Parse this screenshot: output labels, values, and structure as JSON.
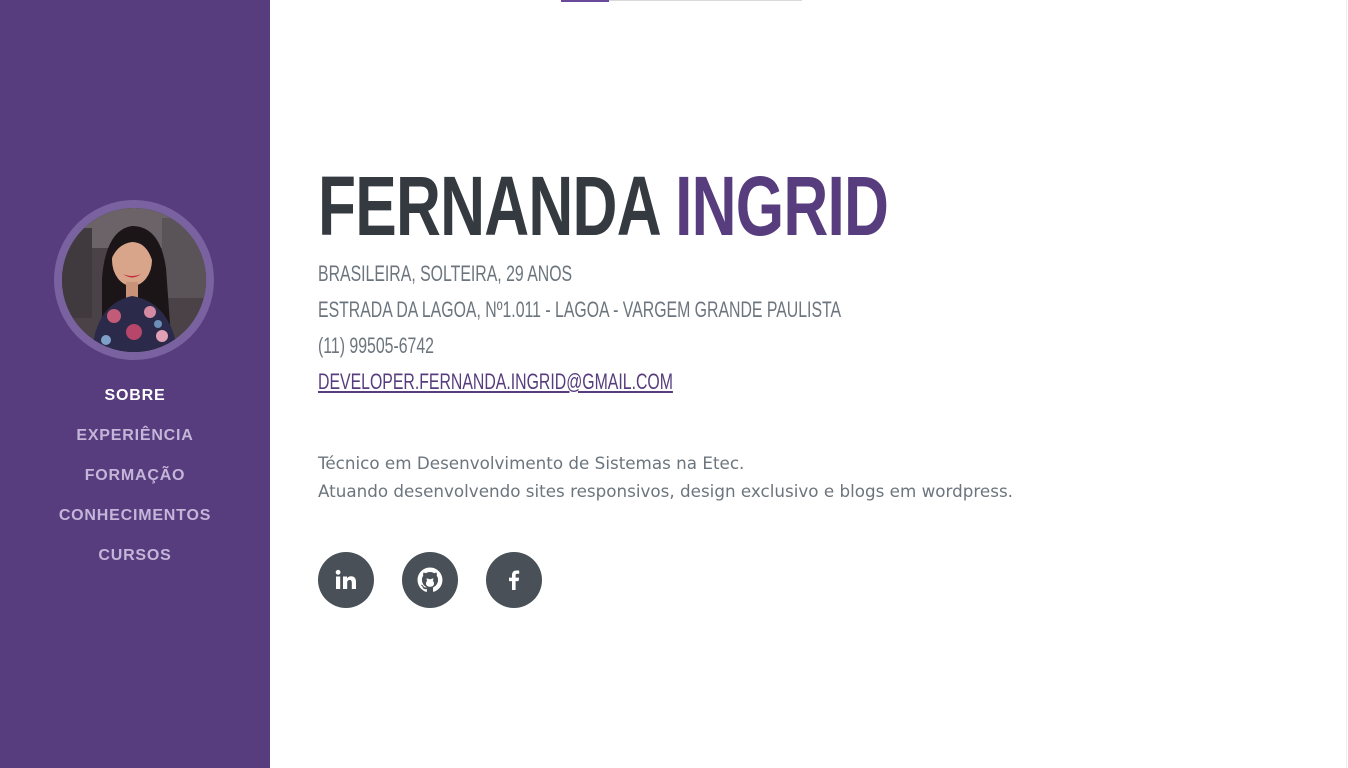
{
  "profile": {
    "first_name": "FERNANDA",
    "last_name": "INGRID",
    "details": [
      "BRASILEIRA, SOLTEIRA, 29 ANOS",
      "ESTRADA DA LAGOA, Nº1.011 - LAGOA - VARGEM GRANDE PAULISTA",
      "(11) 99505-6742"
    ],
    "email": "DEVELOPER.FERNANDA.INGRID@GMAIL.COM",
    "about": [
      "Técnico em Desenvolvimento de Sistemas na Etec.",
      "Atuando desenvolvendo sites responsivos, design exclusivo e blogs em wordpress."
    ]
  },
  "nav": {
    "items": [
      {
        "label": "SOBRE",
        "active": true
      },
      {
        "label": "EXPERIÊNCIA",
        "active": false
      },
      {
        "label": "FORMAÇÃO",
        "active": false
      },
      {
        "label": "CONHECIMENTOS",
        "active": false
      },
      {
        "label": "CURSOS",
        "active": false
      }
    ]
  },
  "social": [
    {
      "icon": "linkedin-icon"
    },
    {
      "icon": "github-icon"
    },
    {
      "icon": "facebook-icon"
    }
  ],
  "colors": {
    "sidebar": "#573d7d",
    "accent": "#573d7d",
    "heading": "#343a40",
    "text": "#6c757d",
    "social_bg": "#495057"
  }
}
